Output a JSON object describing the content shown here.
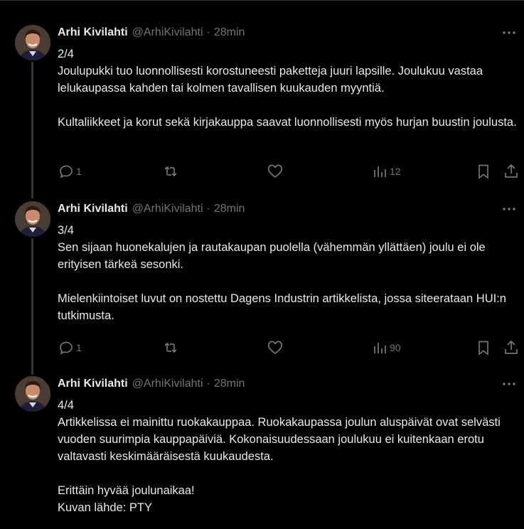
{
  "author": {
    "name": "Arhi Kivilahti",
    "handle": "@ArhiKivilahti",
    "separator": "·",
    "time": "28min"
  },
  "tweets": [
    {
      "counter": "2/4",
      "paragraphs": [
        "Joulupukki tuo luonnollisesti korostuneesti paketteja juuri lapsille. Joulukuu vastaa lelukaupassa kahden tai kolmen tavallisen kuukauden myyntiä.",
        "Kultaliikkeet ja korut sekä kirjakauppa saavat luonnollisesti myös hurjan buustin joulusta."
      ],
      "replies": "1",
      "reposts": "",
      "likes": "",
      "views": "12"
    },
    {
      "counter": "3/4",
      "paragraphs": [
        "Sen sijaan huonekalujen ja rautakaupan puolella (vähemmän yllättäen) joulu ei ole erityisen tärkeä sesonki.",
        "Mielenkiintoiset luvut on nostettu Dagens Industrin artikkelista, jossa siteerataan HUI:n tutkimusta."
      ],
      "replies": "1",
      "reposts": "",
      "likes": "",
      "views": "90"
    },
    {
      "counter": "4/4",
      "paragraphs": [
        "Artikkelissa ei mainittu ruokakauppaa. Ruokakaupassa joulun aluspäivät ovat selvästi vuoden suurimpia kauppapäiviä. Kokonaisuudessaan joulukuu ei kuitenkaan erotu valtavasti keskimääräisestä kuukaudesta.",
        "Erittäin hyvää joulunaikaa!",
        "Kuvan lähde: PTY"
      ]
    }
  ],
  "icons": {
    "more": "more-horizontal-icon",
    "reply": "reply-icon",
    "repost": "repost-icon",
    "like": "heart-icon",
    "views": "views-chart-icon",
    "bookmark": "bookmark-icon",
    "share": "share-icon"
  },
  "colors": {
    "background": "#000000",
    "text": "#e7e9ea",
    "muted": "#71767b",
    "thread_line": "#333639"
  }
}
